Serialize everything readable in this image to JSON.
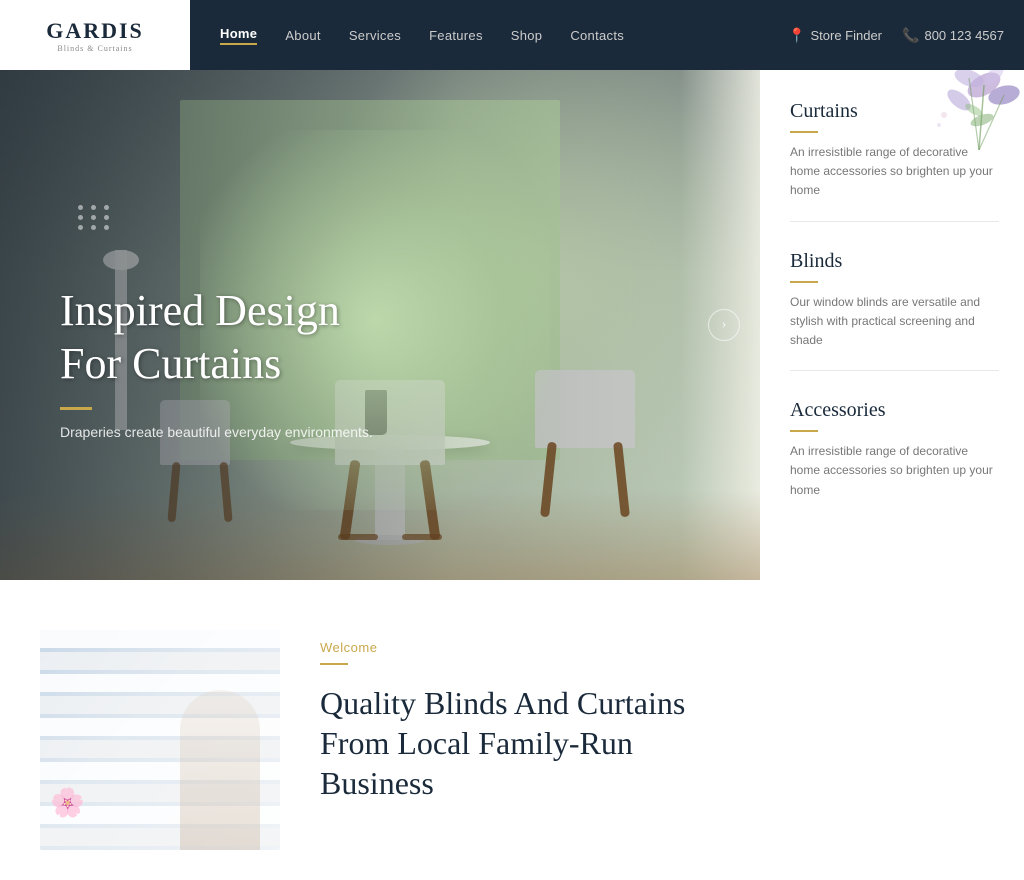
{
  "logo": {
    "main": "GARDIS",
    "sub": "Blinds & Curtains"
  },
  "navbar": {
    "links": [
      {
        "label": "Home",
        "active": true
      },
      {
        "label": "About",
        "active": false
      },
      {
        "label": "Services",
        "active": false
      },
      {
        "label": "Features",
        "active": false
      },
      {
        "label": "Shop",
        "active": false
      },
      {
        "label": "Contacts",
        "active": false
      }
    ],
    "store_finder": "Store Finder",
    "phone": "800 123 4567"
  },
  "hero": {
    "title": "Inspired Design\nFor Curtains",
    "subtitle": "Draperies create beautiful everyday environments.",
    "arrow": "›"
  },
  "sidebar": {
    "items": [
      {
        "title": "Curtains",
        "text": "An irresistible range of decorative home accessories so brighten up your home"
      },
      {
        "title": "Blinds",
        "text": "Our window blinds are versatile and stylish with practical screening and shade"
      },
      {
        "title": "Accessories",
        "text": "An irresistible range of decorative home accessories so brighten up your home"
      }
    ]
  },
  "welcome": {
    "label": "Welcome",
    "title": "Quality Blinds And Curtains From Local Family-Run Business"
  },
  "colors": {
    "accent": "#c9a84c",
    "dark": "#1a2a3a",
    "text_muted": "#777"
  }
}
